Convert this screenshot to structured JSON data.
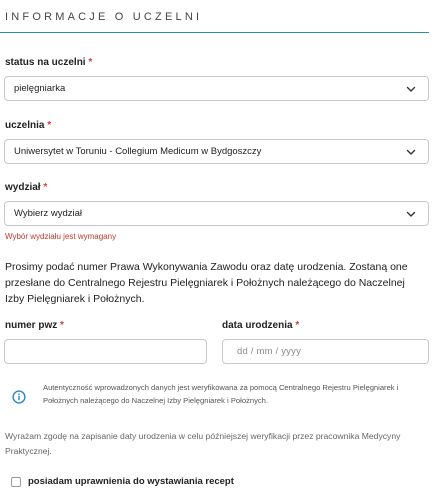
{
  "section": {
    "title": "INFORMACJE O UCZELNI"
  },
  "fields": {
    "status": {
      "label": "status na uczelni",
      "required_mark": "*",
      "value": "pielęgniarka"
    },
    "university": {
      "label": "uczelnia",
      "required_mark": "*",
      "value": "Uniwersytet w Toruniu - Collegium Medicum w Bydgoszczy"
    },
    "faculty": {
      "label": "wydział",
      "required_mark": "*",
      "value": "Wybierz wydział",
      "error": "Wybór wydziału jest wymagany"
    },
    "pwz": {
      "label": "numer pwz",
      "required_mark": "*",
      "value": ""
    },
    "birth_date": {
      "label": "data urodzenia",
      "required_mark": "*",
      "placeholder": "dd / mm / yyyy"
    }
  },
  "info_paragraph": "Prosimy podać numer Prawa Wykonywania Zawodu oraz datę urodzenia. Zostaną one przesłane do Centralnego Rejestru Pielęgniarek i Położnych należącego do Naczelnej Izby Pielęgniarek i Położnych.",
  "verification_note": "Autentyczność wprowadzonych danych jest weryfikowana za pomocą Centralnego Rejestru Pielęgniarek i Położnych należącego do Naczelnej Izby Pielęgniarek i Położnych.",
  "consent_text": "Wyrażam zgodę na zapisanie daty urodzenia w celu późniejszej weryfikacji przez pracownika Medycyny Praktycznej.",
  "prescription_checkbox": {
    "label": "posiadam uprawnienia do wystawiania recept",
    "checked": false
  },
  "colors": {
    "accent": "#2a8f99",
    "required": "#d23c3c",
    "error": "#c0392b",
    "info_icon": "#2b87c9"
  },
  "icons": {
    "select_arrow": "chevron-down-icon",
    "info": "info-icon"
  }
}
